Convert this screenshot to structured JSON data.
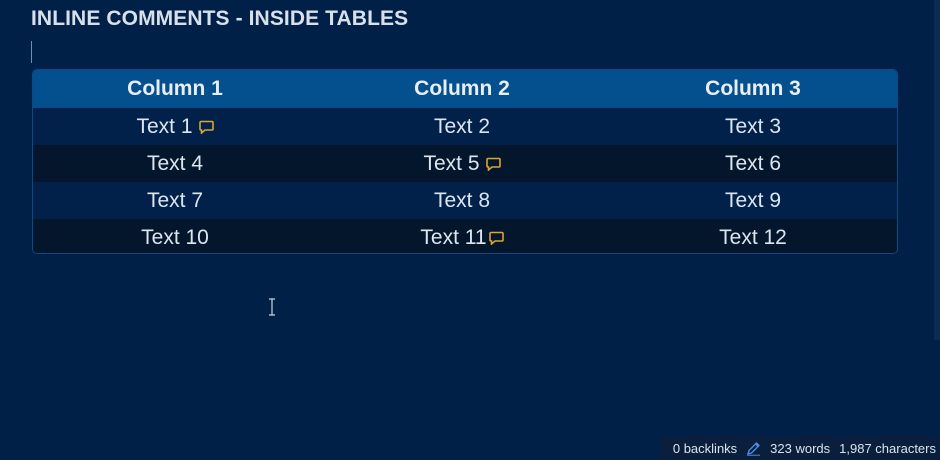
{
  "page": {
    "heading": "INLINE COMMENTS - INSIDE TABLES"
  },
  "table": {
    "headers": [
      "Column 1",
      "Column 2",
      "Column 3"
    ],
    "rows": [
      [
        "Text 1",
        "Text 2",
        "Text 3"
      ],
      [
        "Text 4",
        "Text 5",
        "Text 6"
      ],
      [
        "Text 7",
        "Text 8",
        "Text 9"
      ],
      [
        "Text 10",
        "Text 11",
        "Text 12"
      ]
    ]
  },
  "status_bar": {
    "backlinks": "0 backlinks",
    "words": "323 words",
    "characters": "1,987 characters"
  },
  "colors": {
    "background": "#012048",
    "table_header": "#044f8d",
    "row_alt": "#04162b",
    "comment_icon": "#d9a633",
    "pen_icon": "#4b8be0"
  },
  "icons": {
    "comment": "comment-bubble-icon",
    "pen": "pen-icon",
    "cursor": "text-cursor-icon"
  }
}
